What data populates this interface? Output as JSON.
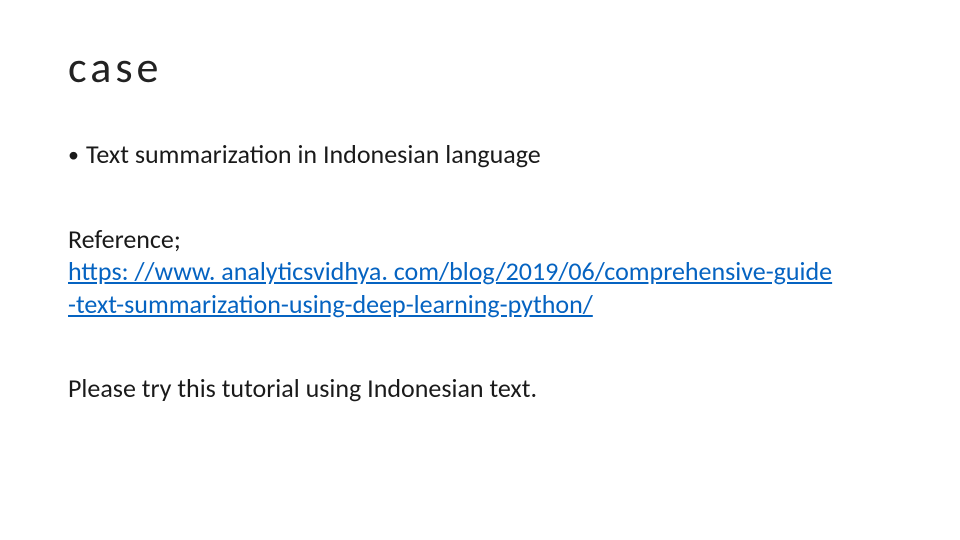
{
  "title": "case",
  "bullet": {
    "dot": "•",
    "text": "Text summarization in Indonesian language"
  },
  "reference": {
    "label": "Reference;",
    "link_line1": "https: //www. analyticsvidhya. com/blog/2019/06/comprehensive-guide",
    "link_line2": "-text-summarization-using-deep-learning-python/"
  },
  "closing": "Please try this tutorial using Indonesian text."
}
